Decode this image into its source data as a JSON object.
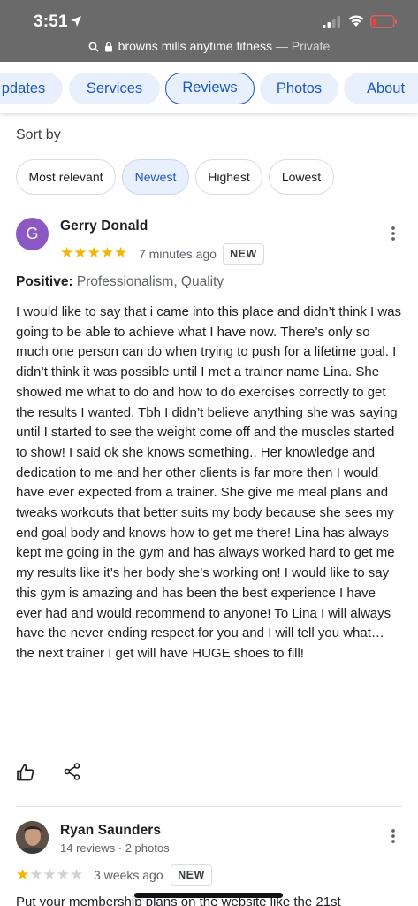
{
  "status_bar": {
    "time": "3:51"
  },
  "browser": {
    "url": "browns mills anytime fitness",
    "mode_suffix": "— Private"
  },
  "tabs": [
    {
      "label": "pdates"
    },
    {
      "label": "Services"
    },
    {
      "label": "Reviews",
      "active": true
    },
    {
      "label": "Photos"
    },
    {
      "label": "About"
    }
  ],
  "sort": {
    "label": "Sort by",
    "options": [
      "Most relevant",
      "Newest",
      "Highest",
      "Lowest"
    ],
    "selected": "Newest"
  },
  "reviews": [
    {
      "avatar_initial": "G",
      "name": "Gerry Donald",
      "rating": 5,
      "time": "7 minutes ago",
      "badge": "NEW",
      "positive_label": "Positive:",
      "positive_value": "Professionalism, Quality",
      "text": "I would like to say that i came into this place and didn’t think I was going to be able to achieve what I have now. There’s only so much one person can do when trying to push for a lifetime goal. I didn’t think it was possible until I met a trainer name Lina. She showed me what to do and how to do exercises correctly to get the results I wanted. Tbh I didn’t believe anything she was saying until I started to see the weight come off and the muscles started to show! I said ok she knows something.. Her knowledge and dedication to me and her other clients is far more then I would have ever expected from a trainer. She give me meal plans and tweaks workouts that better suits my body because she sees my end goal body and knows how to get me there! Lina has always kept me going in the gym and has always worked hard to get me my results like it’s her body she’s working on! I would like to say this gym is amazing and has been the best experience I have ever had and would recommend to anyone! To Lina I will always have the never ending respect for you and I will tell you what… the next trainer I get will have HUGE shoes to fill!"
    },
    {
      "name": "Ryan Saunders",
      "subtitle": "14 reviews · 2 photos",
      "rating": 1,
      "time": "3 weeks ago",
      "badge": "NEW",
      "text_preview": "Put your membership plans on the website like the 21st"
    }
  ],
  "colors": {
    "accent": "#1a56c8",
    "star": "#f4b400",
    "avatar": "#8c59c4"
  }
}
